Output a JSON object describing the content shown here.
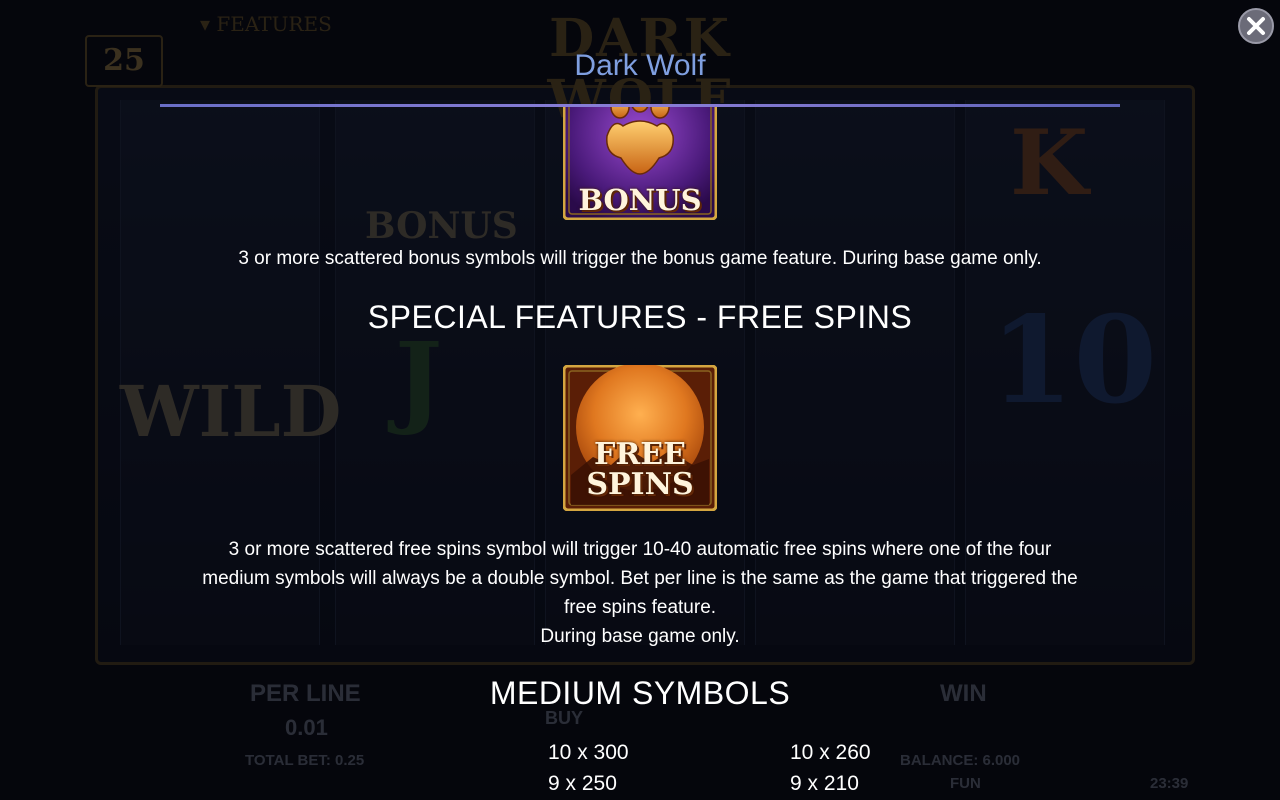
{
  "background": {
    "title": "DARK WOLF",
    "features_tab": "▾ FEATURES",
    "lines": "25",
    "reel_symbols": [
      "BONUS",
      "K",
      "WILD",
      "J",
      "10"
    ],
    "per_line_label": "PER LINE",
    "per_line_value": "0.01",
    "total_bet": "TOTAL BET: 0.25",
    "buy_label": "BUY",
    "win_label": "WIN",
    "balance": "BALANCE: 6.000",
    "currency": "FUN",
    "time": "23:39"
  },
  "panel": {
    "title": "Dark Wolf",
    "close_icon": "close-x-icon"
  },
  "bonus": {
    "symbol_label": "BONUS",
    "description": "3 or more scattered bonus symbols will trigger the bonus game feature. During base game only."
  },
  "free_spins": {
    "heading": "SPECIAL FEATURES - FREE SPINS",
    "symbol_line1": "FREE",
    "symbol_line2": "SPINS",
    "description_line1": "3 or more scattered free spins symbol will trigger 10-40 automatic free spins where one of the four",
    "description_line2": "medium symbols will always be a double symbol. Bet per line is the same as the game that triggered the",
    "description_line3": "free spins feature.",
    "description_line4": "During base game only."
  },
  "medium_symbols": {
    "heading": "MEDIUM SYMBOLS",
    "columns": [
      {
        "rows": [
          "10 x 300",
          "9 x 250"
        ]
      },
      {
        "rows": [
          "10 x 260",
          "9 x 210"
        ]
      }
    ]
  },
  "colors": {
    "title": "#7f9fe0",
    "rule": "#6a6fc8",
    "bonus_bg": "#5a2a8a",
    "free_spins_bg": "#c8621a",
    "gold": "#d4a640"
  }
}
